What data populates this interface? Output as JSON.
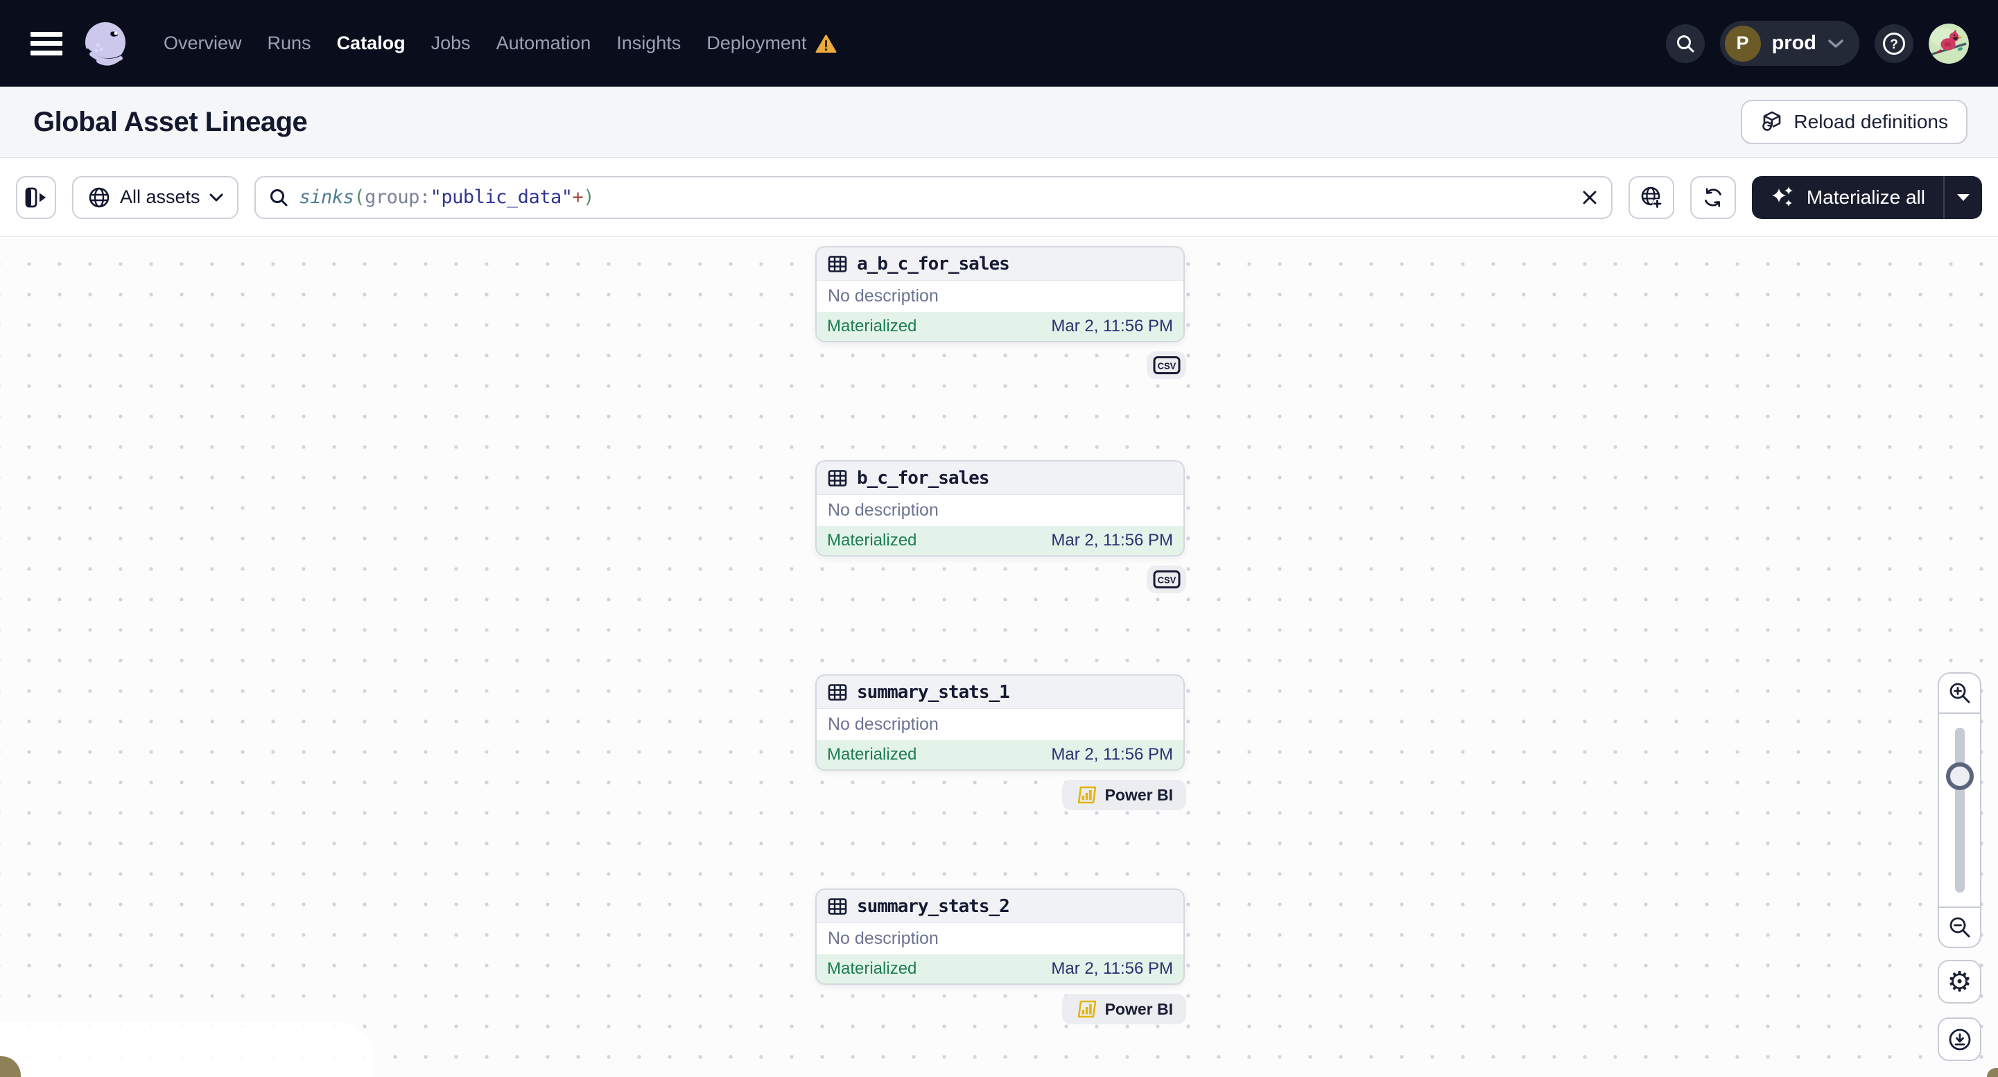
{
  "nav": {
    "items": [
      {
        "label": "Overview"
      },
      {
        "label": "Runs"
      },
      {
        "label": "Catalog"
      },
      {
        "label": "Jobs"
      },
      {
        "label": "Automation"
      },
      {
        "label": "Insights"
      },
      {
        "label": "Deployment",
        "warning": true
      }
    ],
    "active_item": "Catalog",
    "env": {
      "initial": "P",
      "name": "prod"
    },
    "icons": [
      "menu-icon",
      "dagster-logo",
      "warning-icon",
      "search-icon",
      "help-icon",
      "user-avatar"
    ]
  },
  "header": {
    "title": "Global Asset Lineage",
    "reload_label": "Reload definitions"
  },
  "toolbar": {
    "scope_label": "All assets",
    "query": {
      "tokens": [
        {
          "text": "sinks",
          "type": "fn"
        },
        {
          "text": "(",
          "type": "paren"
        },
        {
          "text": "group:",
          "type": "attr"
        },
        {
          "text": "\"public_data\"",
          "type": "string"
        },
        {
          "text": "+",
          "type": "op"
        },
        {
          "text": ")",
          "type": "paren"
        }
      ]
    },
    "materialize_label": "Materialize all",
    "icons": [
      "panel-toggle-icon",
      "globe-icon",
      "search-icon",
      "clear-icon",
      "globe-add-icon",
      "refresh-icon",
      "sparkles-icon",
      "caret-down-icon"
    ]
  },
  "canvas": {
    "assets": [
      {
        "name": "a_b_c_for_sales",
        "description": "No description",
        "status": "Materialized",
        "timestamp": "Mar 2, 11:56 PM",
        "tag": "CSV",
        "tag_kind": "csv"
      },
      {
        "name": "b_c_for_sales",
        "description": "No description",
        "status": "Materialized",
        "timestamp": "Mar 2, 11:56 PM",
        "tag": "CSV",
        "tag_kind": "csv"
      },
      {
        "name": "summary_stats_1",
        "description": "No description",
        "status": "Materialized",
        "timestamp": "Mar 2, 11:56 PM",
        "tag": "Power BI",
        "tag_kind": "powerbi"
      },
      {
        "name": "summary_stats_2",
        "description": "No description",
        "status": "Materialized",
        "timestamp": "Mar 2, 11:56 PM",
        "tag": "Power BI",
        "tag_kind": "powerbi"
      }
    ]
  },
  "zoom_controls": {
    "icons": [
      "zoom-in-icon",
      "zoom-out-icon",
      "zoom-slider",
      "gear-icon",
      "download-icon"
    ],
    "gear_glyph": "⚙"
  },
  "colors": {
    "nav_bg": "#0a0d1c",
    "accent_dark": "#181c2d",
    "materialized_bg": "#e3f3e9",
    "materialized_text": "#1d7c51",
    "timestamp_text": "#2b3170",
    "powerbi_yellow": "#e3b50c",
    "warning_orange": "#ecab3d",
    "logo_lavender": "#cbc8ec",
    "env_avatar_brown": "#6d5b27"
  }
}
